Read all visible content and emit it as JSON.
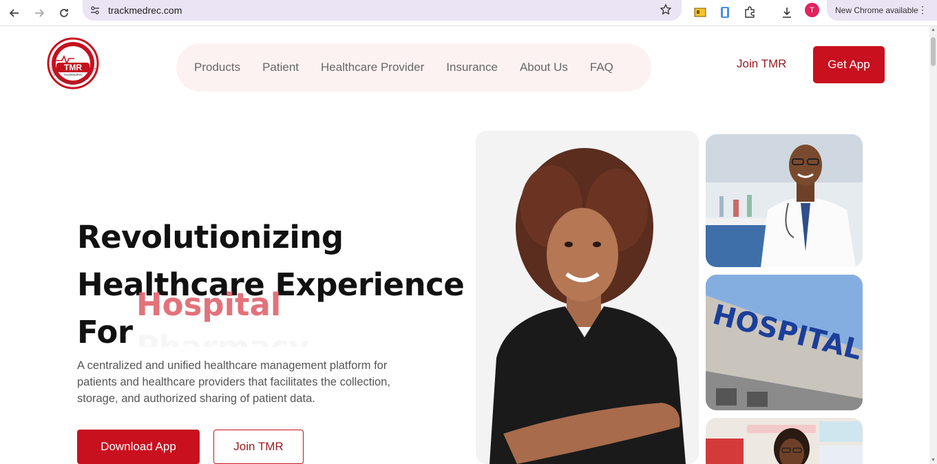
{
  "browser": {
    "url": "trackmedrec.com",
    "avatar_initial": "T",
    "update_text": "New Chrome available"
  },
  "logo": {
    "text": "TMR",
    "subtext": "TrackMedRec",
    "ring_text": "YOUR RECORDS YOUR DESIGN"
  },
  "nav": {
    "items": [
      {
        "label": "Products"
      },
      {
        "label": "Patient"
      },
      {
        "label": "Healthcare Provider"
      },
      {
        "label": "Insurance"
      },
      {
        "label": "About Us"
      },
      {
        "label": "FAQ"
      }
    ],
    "join_label": "Join TMR",
    "get_app_label": "Get App"
  },
  "hero": {
    "title_line1": "Revolutionizing",
    "title_line2": "Healthcare Experience",
    "title_line3": "For",
    "rotating_word_current": "Hospital",
    "rotating_word_next": "Pharmacy",
    "description": "A centralized and unified healthcare management platform for patients and healthcare providers that facilitates the collection, storage, and authorized sharing of patient data.",
    "download_label": "Download App",
    "join_label": "Join TMR"
  },
  "images": {
    "hospital_sign": "HOSPITAL"
  },
  "colors": {
    "brand_red": "#c8101e",
    "brand_dark_red": "#9b1b22",
    "accent_pink": "#e06770",
    "nav_pill_bg": "#fdf2f2"
  }
}
